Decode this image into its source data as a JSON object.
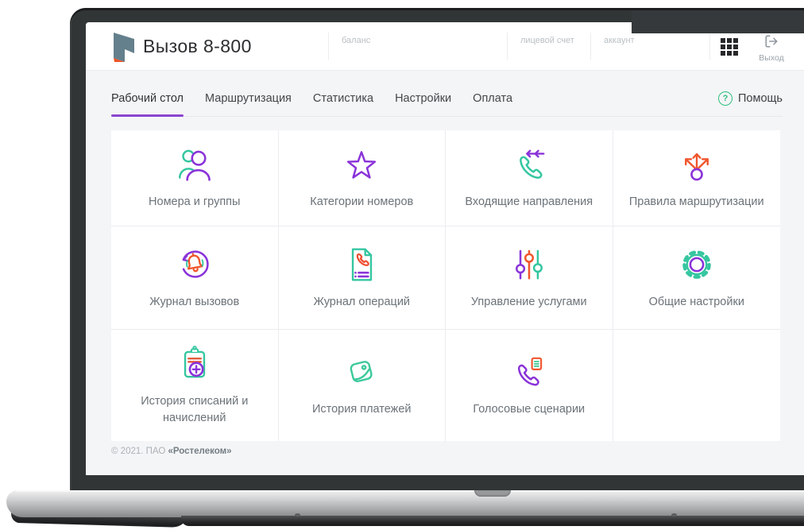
{
  "header": {
    "title": "Вызов 8-800",
    "balance_label": "баланс",
    "personal_account_label": "лицевой счет",
    "account_label": "аккаунт",
    "logout_label": "Выход"
  },
  "nav": {
    "tabs": [
      {
        "label": "Рабочий стол",
        "active": true
      },
      {
        "label": "Маршрутизация",
        "active": false
      },
      {
        "label": "Статистика",
        "active": false
      },
      {
        "label": "Настройки",
        "active": false
      },
      {
        "label": "Оплата",
        "active": false
      }
    ],
    "help_label": "Помощь",
    "help_icon_glyph": "?"
  },
  "tiles": [
    {
      "label": "Номера и группы",
      "icon": "users-icon"
    },
    {
      "label": "Категории номеров",
      "icon": "star-icon"
    },
    {
      "label": "Входящие направления",
      "icon": "incoming-call-icon"
    },
    {
      "label": "Правила маршрутизации",
      "icon": "routing-icon"
    },
    {
      "label": "Журнал вызовов",
      "icon": "call-log-icon"
    },
    {
      "label": "Журнал операций",
      "icon": "operations-log-icon"
    },
    {
      "label": "Управление услугами",
      "icon": "sliders-icon"
    },
    {
      "label": "Общие настройки",
      "icon": "gear-icon"
    },
    {
      "label": "История списаний и начислений",
      "icon": "billing-history-icon"
    },
    {
      "label": "История платежей",
      "icon": "wallet-icon"
    },
    {
      "label": "Голосовые сценарии",
      "icon": "voice-script-icon"
    }
  ],
  "footer": {
    "copyright_prefix": "© 2021. ПАО ",
    "company": "«Ростелеком»"
  },
  "colors": {
    "accent_purple": "#8a33d9",
    "accent_teal": "#35c6a0",
    "accent_orange": "#f0562d",
    "help_green": "#2fbf7f",
    "active_tab_underline": "#8a44cf"
  }
}
